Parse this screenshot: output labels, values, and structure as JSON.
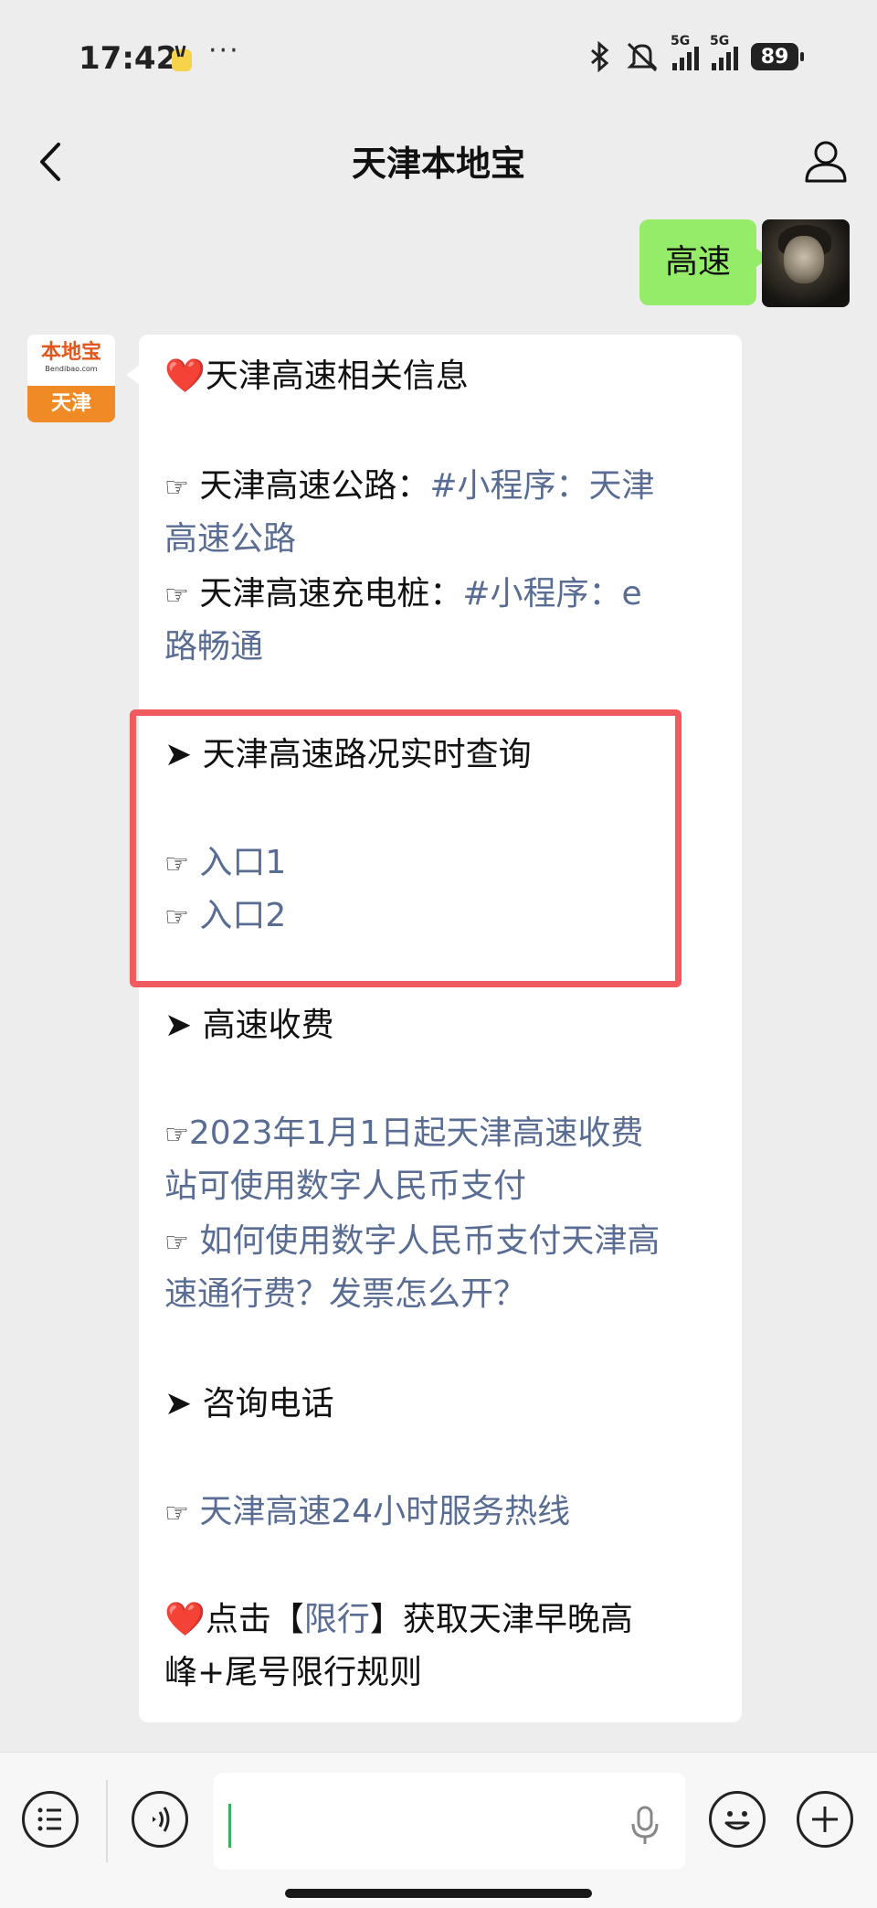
{
  "status": {
    "time": "17:42",
    "dots": "···",
    "signal1": "5G",
    "signal2": "5G",
    "battery": "89"
  },
  "nav": {
    "title": "天津本地宝"
  },
  "chat": {
    "user_message": "高速",
    "bot_avatar": {
      "logo": "本地宝",
      "site": "Bendibao.com",
      "city": "天津"
    },
    "reply": {
      "heading": "天津高速相关信息",
      "line1_label": "天津高速公路：",
      "line1_link_a": "#小程序：天津",
      "line1_link_b": "高速公路",
      "line2_label": "天津高速充电桩：",
      "line2_link_a": "#小程序：e",
      "line2_link_b": "路畅通",
      "section1": "天津高速路况实时查询",
      "entry1": "入口1",
      "entry2": "入口2",
      "section2": "高速收费",
      "fee1_a": "2023年1月1日起天津高速收费",
      "fee1_b": "站可使用数字人民币支付",
      "fee2_a": "如何使用数字人民币支付天津高",
      "fee2_b": "速通行费？发票怎么开？",
      "section3": "咨询电话",
      "hotline": "天津高速24小时服务热线",
      "footer_prefix": "点击【",
      "footer_link": "限行",
      "footer_suffix": "】获取天津早晚高",
      "footer_b": "峰+尾号限行规则"
    }
  },
  "symbols": {
    "heart": "❤️",
    "point": "☞",
    "arrow": "➤"
  }
}
